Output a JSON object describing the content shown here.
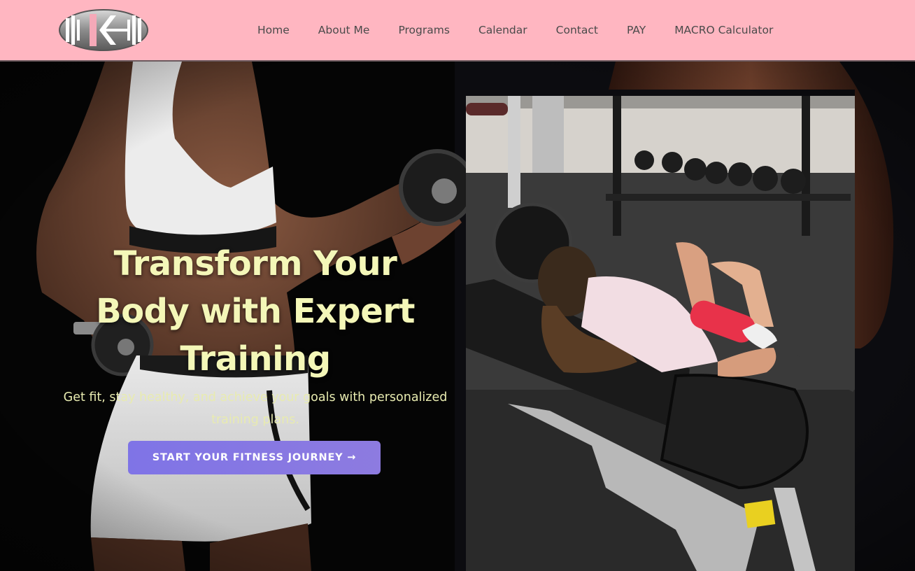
{
  "nav": {
    "items": [
      "Home",
      "About Me",
      "Programs",
      "Calendar",
      "Contact",
      "PAY",
      "MACRO Calculator"
    ]
  },
  "hero": {
    "title": "Transform Your Body with Expert Training",
    "subtitle": "Get fit, stay healthy, and achieve your goals with personalized training plans.",
    "cta_label": "START YOUR FITNESS JOURNEY →"
  },
  "colors": {
    "header_bg": "#ffb6c1",
    "title": "#f4f7b8",
    "cta": "#7f74e6"
  },
  "icons": {
    "logo": "barbell-logo-icon"
  }
}
